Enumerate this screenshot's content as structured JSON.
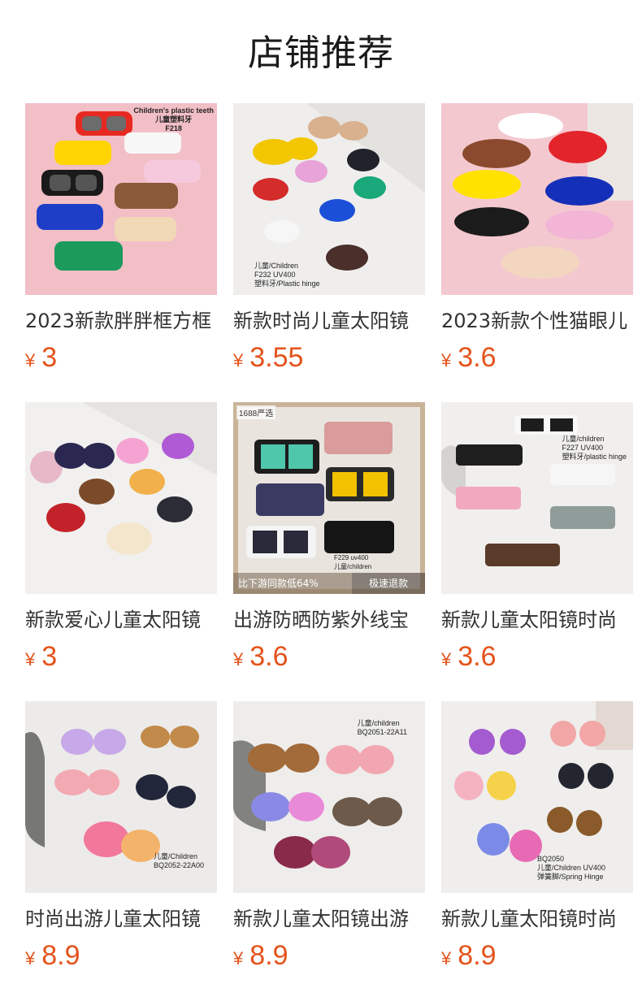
{
  "section": {
    "title": "店铺推荐"
  },
  "colors": {
    "price": "#e4531c",
    "title": "#1a1a1a",
    "name": "#333333"
  },
  "products": [
    {
      "name": "2023新款胖胖框方框",
      "currency": "¥",
      "price": "3",
      "image_text": [
        "Children's plastic teeth",
        "儿童塑料牙",
        "F218"
      ],
      "image_bg": "#f2bfc6"
    },
    {
      "name": "新款时尚儿童太阳镜",
      "currency": "¥",
      "price": "3.55",
      "image_text": [
        "儿童/Children",
        "F232  UV400",
        "塑料牙/Plastic hinge"
      ],
      "image_bg": "#efeeed"
    },
    {
      "name": "2023新款个性猫眼儿",
      "currency": "¥",
      "price": "3.6",
      "image_text": [],
      "image_bg": "#f4c8cf"
    },
    {
      "name": "新款爱心儿童太阳镜",
      "currency": "¥",
      "price": "3",
      "image_text": [],
      "image_bg": "#f1f0ef"
    },
    {
      "name": "出游防晒防紫外线宝",
      "currency": "¥",
      "price": "3.6",
      "image_text": [
        "F229  uv400",
        "儿童/children"
      ],
      "badge": "1688严选",
      "band_left": "比下游同款低64%",
      "band_right": "极速退款",
      "image_bg": "#e5ded3"
    },
    {
      "name": "新款儿童太阳镜时尚",
      "currency": "¥",
      "price": "3.6",
      "image_text": [
        "儿童/children",
        "F227  UV400",
        "塑料牙/plastic hinge"
      ],
      "image_bg": "#f0efed"
    },
    {
      "name": "时尚出游儿童太阳镜",
      "currency": "¥",
      "price": "8.9",
      "image_text": [
        "儿童/Children",
        "BQ2052-22A00"
      ],
      "image_bg": "#ecebe9"
    },
    {
      "name": "新款儿童太阳镜出游",
      "currency": "¥",
      "price": "8.9",
      "image_text": [
        "儿童/children",
        "BQ2051-22A11"
      ],
      "image_bg": "#eeedeb"
    },
    {
      "name": "新款儿童太阳镜时尚",
      "currency": "¥",
      "price": "8.9",
      "image_text": [
        "BQ2050",
        "儿童/Children UV400",
        "弹簧脚/Spring Hinge"
      ],
      "image_bg": "#efeeec"
    }
  ]
}
